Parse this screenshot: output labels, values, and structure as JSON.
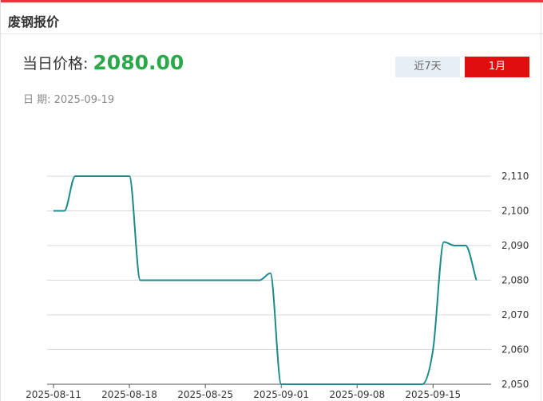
{
  "header": {
    "title": "废钢报价"
  },
  "price": {
    "label": "当日价格:",
    "value": "2080.00"
  },
  "date": {
    "label": "日 期:",
    "value": "2025-09-19"
  },
  "range_buttons": [
    {
      "label": "近7天",
      "active": false
    },
    {
      "label": "1月",
      "active": true
    }
  ],
  "colors": {
    "accent_red": "#e00e0e",
    "price_green": "#2aa84a",
    "line": "#1a8a8a",
    "inactive_button": "#e8eef6"
  },
  "chart_data": {
    "type": "line",
    "x_ticks": [
      "2025-08-11",
      "2025-08-18",
      "2025-08-25",
      "2025-09-01",
      "2025-09-08",
      "2025-09-15"
    ],
    "y_ticks": [
      "2,050",
      "2,060",
      "2,070",
      "2,080",
      "2,090",
      "2,100",
      "2,110"
    ],
    "ylim": [
      2050,
      2110
    ],
    "grid": true,
    "y_axis_side": "right",
    "series": [
      {
        "dates": [
          "2025-08-11",
          "2025-08-12",
          "2025-08-13",
          "2025-08-14",
          "2025-08-15",
          "2025-08-16",
          "2025-08-17",
          "2025-08-18",
          "2025-08-19",
          "2025-08-20",
          "2025-08-21",
          "2025-08-22",
          "2025-08-23",
          "2025-08-24",
          "2025-08-25",
          "2025-08-26",
          "2025-08-27",
          "2025-08-28",
          "2025-08-29",
          "2025-08-30",
          "2025-08-31",
          "2025-09-01",
          "2025-09-02",
          "2025-09-03",
          "2025-09-04",
          "2025-09-05",
          "2025-09-06",
          "2025-09-07",
          "2025-09-08",
          "2025-09-09",
          "2025-09-10",
          "2025-09-11",
          "2025-09-12",
          "2025-09-13",
          "2025-09-14",
          "2025-09-15",
          "2025-09-16",
          "2025-09-17",
          "2025-09-18",
          "2025-09-19"
        ],
        "values": [
          2100,
          2100,
          2110,
          2110,
          2110,
          2110,
          2110,
          2110,
          2080,
          2080,
          2080,
          2080,
          2080,
          2080,
          2080,
          2080,
          2080,
          2080,
          2080,
          2080,
          2082,
          2050,
          2050,
          2050,
          2050,
          2050,
          2050,
          2050,
          2050,
          2050,
          2050,
          2050,
          2050,
          2050,
          2050,
          2060,
          2091,
          2090,
          2090,
          2080
        ]
      }
    ]
  }
}
